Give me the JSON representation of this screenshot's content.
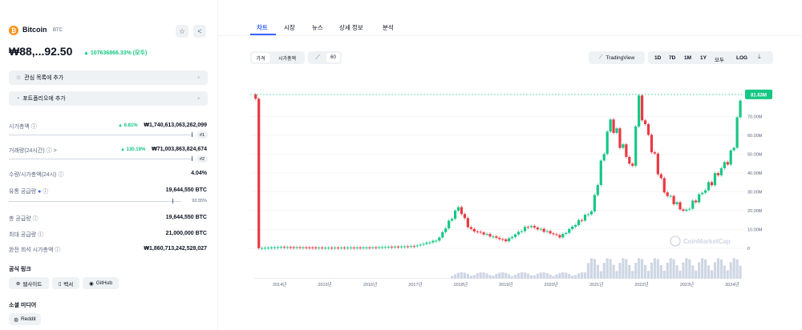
{
  "coin": {
    "name": "Bitcoin",
    "symbol": "BTC",
    "price": "₩88,...92.50",
    "change": "▲ 107636866.33% (모두)"
  },
  "actions": {
    "watchlist": "관심 목록에 추가",
    "portfolio": "포트폴리오에 추가"
  },
  "stats": [
    {
      "label": "시가총액",
      "change": "▲ 6.81%",
      "value": "₩1,740,613,063,262,099",
      "rank": "#1"
    },
    {
      "label": "거래량(24시간)",
      "change": "▲ 130.19%",
      "value": "₩71,003,863,824,674",
      "rank": "#2"
    },
    {
      "label": "수량/시가총액(24시)",
      "value": "4.04%"
    },
    {
      "label": "유통 공급량",
      "value": "19,644,550 BTC",
      "pct": "93.55%",
      "pct_value": 0.9355
    },
    {
      "label": "총 공급량",
      "value": "19,644,550 BTC"
    },
    {
      "label": "최대 공급량",
      "value": "21,000,000 BTC"
    },
    {
      "label": "완전 희석 시가총액",
      "value": "₩1,860,713,242,528,027"
    }
  ],
  "links": {
    "title": "공식 링크",
    "items": [
      "웹사이트",
      "백서",
      "GitHub"
    ]
  },
  "social": {
    "title": "소셜 미디어",
    "items": [
      "Reddit"
    ]
  },
  "tabs": [
    "차트",
    "시장",
    "뉴스",
    "상세 정보",
    "분석"
  ],
  "controls": {
    "view_modes": [
      "가격",
      "시가총액"
    ],
    "interval": "60",
    "tradingview": "TradingView",
    "ranges": [
      "1D",
      "7D",
      "1M",
      "1Y",
      "모두",
      "LOG"
    ]
  },
  "chart_data": {
    "type": "line",
    "current_label": "81.63M",
    "watermark": "CoinMarketCap",
    "y_ticks": [
      "70.00M",
      "60.00M",
      "50.00M",
      "40.00M",
      "30.00M",
      "20.00M",
      "10.00M",
      "0"
    ],
    "y_values": [
      70000000,
      60000000,
      50000000,
      40000000,
      30000000,
      20000000,
      10000000,
      0
    ],
    "x_ticks": [
      "2014년",
      "2015년",
      "2016년",
      "2017년",
      "2018년",
      "2019년",
      "2020년",
      "2021년",
      "2022년",
      "2023년",
      "2024년"
    ],
    "x": [
      "2013.5",
      "2014",
      "2015",
      "2016",
      "2017",
      "2017.5",
      "2017.95",
      "2018.2",
      "2018.6",
      "2019",
      "2019.5",
      "2020",
      "2020.2",
      "2020.9",
      "2021.3",
      "2021.8",
      "2021.9",
      "2022.5",
      "2022.95",
      "2023.5",
      "2024",
      "2024.2"
    ],
    "price": [
      0,
      700000,
      300000,
      450000,
      1200000,
      4500000,
      22000000,
      10000000,
      7000000,
      4000000,
      12000000,
      8000000,
      6000000,
      20000000,
      68000000,
      42000000,
      80000000,
      30000000,
      19000000,
      34000000,
      50000000,
      81630000
    ],
    "ylim": [
      0,
      85000000
    ]
  },
  "colors": {
    "up": "#16c784",
    "down": "#ea3943",
    "accent": "#3861fb"
  }
}
